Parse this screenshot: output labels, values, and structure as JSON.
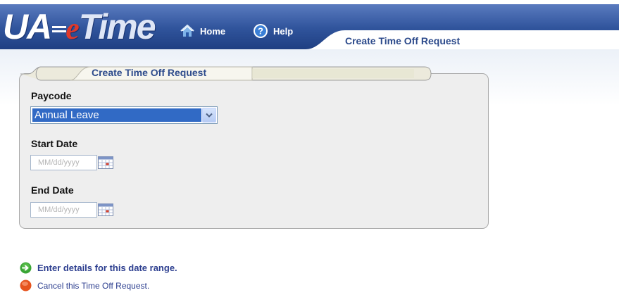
{
  "header": {
    "logo": {
      "prefix": "UA",
      "e": "e",
      "suffix": "Time"
    },
    "nav": [
      {
        "label": "Home",
        "icon": "home-icon"
      },
      {
        "label": "Help",
        "icon": "help-icon"
      }
    ],
    "page_title": "Create Time Off Request"
  },
  "form": {
    "title": "Create Time Off Request",
    "paycode": {
      "label": "Paycode",
      "value": "Annual Leave"
    },
    "start_date": {
      "label": "Start Date",
      "placeholder": "MM/dd/yyyy"
    },
    "end_date": {
      "label": "End Date",
      "placeholder": "MM/dd/yyyy"
    }
  },
  "actions": {
    "enter": {
      "label": "Enter details for this date range.",
      "icon": "green-arrow-icon"
    },
    "cancel": {
      "label": "Cancel this Time Off Request.",
      "icon": "orange-circle-icon"
    }
  },
  "colors": {
    "header_blue": "#30549c",
    "link_blue": "#2c3e8f",
    "select_highlight": "#316ac5",
    "panel_bg": "#eeeeee",
    "logo_e_red": "#e0392a"
  }
}
